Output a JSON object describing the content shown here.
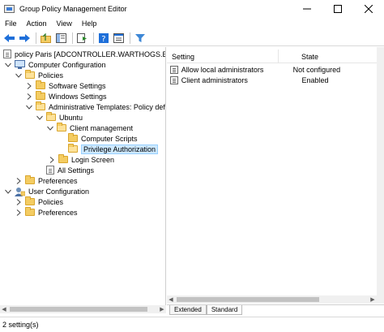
{
  "window": {
    "title": "Group Policy Management Editor"
  },
  "menu": {
    "items": [
      "File",
      "Action",
      "View",
      "Help"
    ]
  },
  "tree": {
    "root": "policy Paris [ADCONTROLLER.WARTHOGS.BIZ] P",
    "computer_configuration": "Computer Configuration",
    "policies": "Policies",
    "software_settings": "Software Settings",
    "windows_settings": "Windows Settings",
    "administrative_templates": "Administrative Templates: Policy defin",
    "ubuntu": "Ubuntu",
    "client_management": "Client management",
    "computer_scripts": "Computer Scripts",
    "privilege_authorization": "Privilege Authorization",
    "login_screen": "Login Screen",
    "all_settings": "All Settings",
    "preferences_computer": "Preferences",
    "user_configuration": "User Configuration",
    "user_policies": "Policies",
    "user_preferences": "Preferences"
  },
  "list": {
    "headers": {
      "setting": "Setting",
      "state": "State"
    },
    "rows": [
      {
        "setting": "Allow local administrators",
        "state": "Not configured"
      },
      {
        "setting": "Client administrators",
        "state": "Enabled"
      }
    ]
  },
  "tabs": {
    "extended": "Extended",
    "standard": "Standard"
  },
  "status": {
    "text": "2 setting(s)"
  },
  "colors": {
    "selection": "#cce8ff",
    "folder": "#f4cc62",
    "toolbar_blue": "#1e6fd9"
  }
}
